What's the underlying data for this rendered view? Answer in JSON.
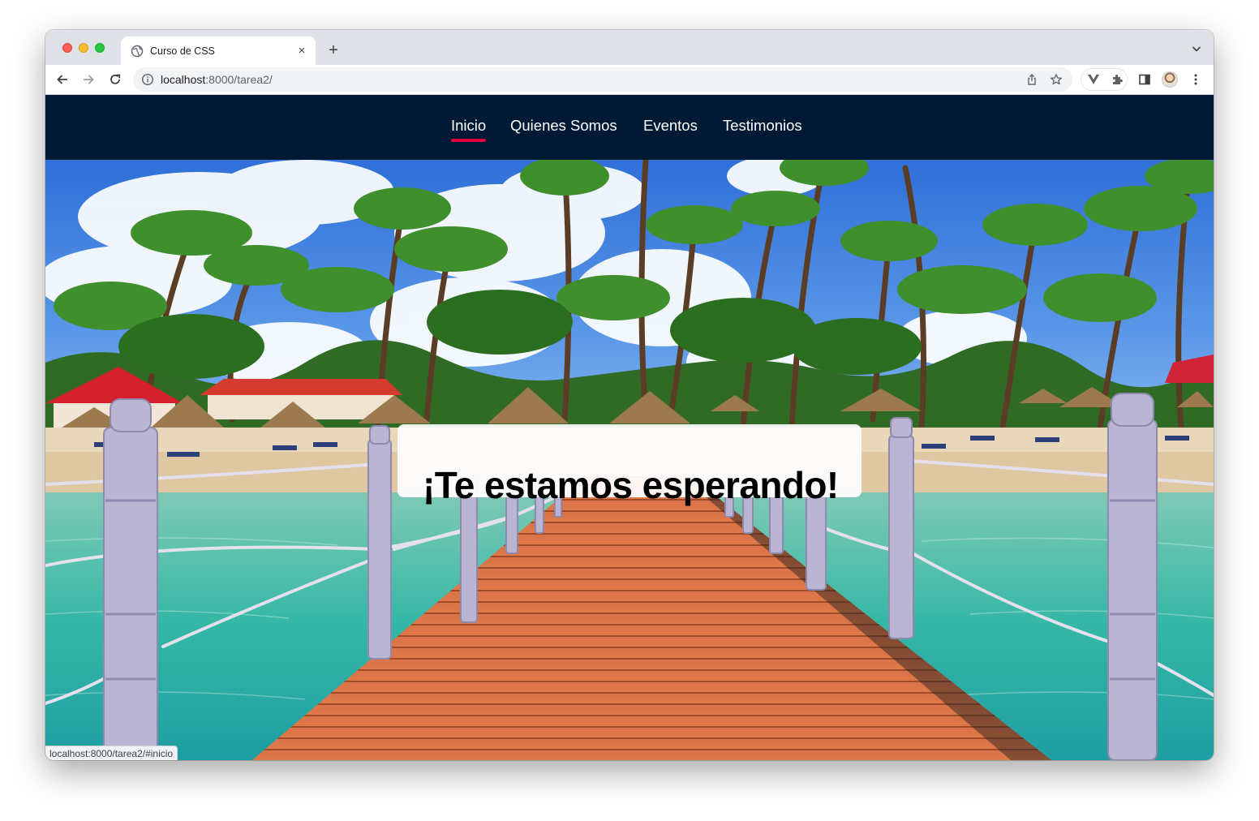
{
  "browser": {
    "tab_title": "Curso de CSS",
    "url_host": "localhost",
    "url_rest": ":8000/tarea2/",
    "new_tab_label": "+",
    "close_tab_label": "×"
  },
  "site": {
    "nav": [
      {
        "label": "Inicio",
        "active": true
      },
      {
        "label": "Quienes Somos",
        "active": false
      },
      {
        "label": "Eventos",
        "active": false
      },
      {
        "label": "Testimonios",
        "active": false
      }
    ],
    "hero_title": "¡Te estamos esperando!"
  },
  "status_bar": "localhost:8000/tarea2/#inicio",
  "colors": {
    "nav_background": "#001a35",
    "active_underline": "#e0003b",
    "tab_strip": "#dee1e6"
  },
  "icons": [
    "globe-icon",
    "close-icon",
    "plus-icon",
    "chevron-down-icon",
    "back-arrow-icon",
    "forward-arrow-icon",
    "reload-icon",
    "info-icon",
    "share-icon",
    "star-icon",
    "vuejs-devtools-icon",
    "extensions-icon",
    "side-panel-icon",
    "kebab-menu-icon"
  ]
}
